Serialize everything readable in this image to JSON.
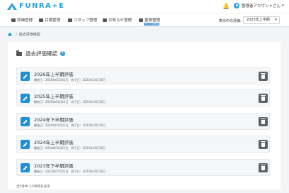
{
  "header": {
    "logo_text": "FUNRA+E",
    "user_name": "管理者アカウントさん"
  },
  "nav": {
    "items": [
      {
        "label": "評価管理",
        "icon": "bar-chart-icon"
      },
      {
        "label": "目標管理",
        "icon": "target-icon"
      },
      {
        "label": "スタッフ管理",
        "icon": "id-card-icon"
      },
      {
        "label": "お知らせ管理",
        "icon": "megaphone-icon"
      },
      {
        "label": "査設管理",
        "icon": "monitor-icon"
      }
    ],
    "active_badge": "過去評価確認",
    "period_label": "表示中の評価:",
    "period_value": "2023年上半期"
  },
  "breadcrumb": {
    "current": "過去評価確認"
  },
  "page": {
    "title": "過去評価確認",
    "help": "?",
    "accent_color": "#1e8fd9",
    "delete_color": "#5e6166"
  },
  "evaluations": [
    {
      "title": "2026年上半期評価",
      "start": "開始日：2020年01月01日",
      "end": "終了日：2023年10月16日"
    },
    {
      "title": "2025年上半期評価",
      "start": "開始日：2020年01月01日",
      "end": "終了日：2023年10月16日"
    },
    {
      "title": "2024年下半期評価",
      "start": "開始日：2024年01月01日",
      "end": "終了日：2023年10月16日"
    },
    {
      "title": "2024年上半期評価",
      "start": "開始日：2024年01月01日",
      "end": "終了日：2023年10月16日"
    },
    {
      "title": "2023年下半期評価",
      "start": "開始日：2023年07月01日",
      "end": "終了日：2023年10月16日"
    }
  ],
  "footer": {
    "count_text": "全5件中 1-5件目を表示"
  }
}
